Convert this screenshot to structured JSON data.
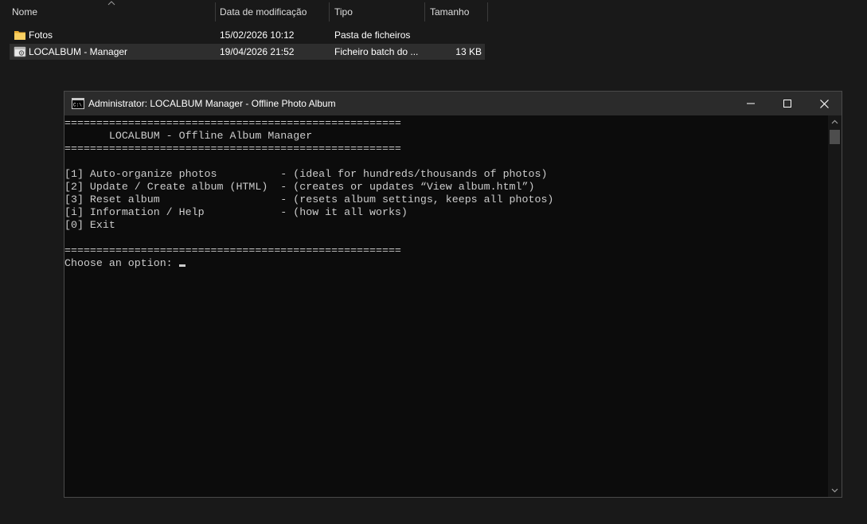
{
  "explorer": {
    "columns": {
      "name": "Nome",
      "modified": "Data de modificação",
      "type": "Tipo",
      "size": "Tamanho"
    },
    "rows": [
      {
        "name": "Fotos",
        "modified": "15/02/2026 10:12",
        "type": "Pasta de ficheiros",
        "size": "",
        "icon": "folder-icon"
      },
      {
        "name": "LOCALBUM - Manager",
        "modified": "19/04/2026 21:52",
        "type": "Ficheiro batch do ...",
        "size": "13 KB",
        "icon": "batch-file-icon"
      }
    ]
  },
  "console": {
    "title": "Administrator:  LOCALBUM Manager - Offline Photo Album",
    "lines": [
      "=====================================================",
      "       LOCALBUM - Offline Album Manager",
      "=====================================================",
      "",
      "[1] Auto-organize photos          - (ideal for hundreds/thousands of photos)",
      "[2] Update / Create album (HTML)  - (creates or updates “View album.html”)",
      "[3] Reset album                   - (resets album settings, keeps all photos)",
      "[i] Information / Help            - (how it all works)",
      "[0] Exit",
      "",
      "=====================================================",
      "Choose an option: "
    ]
  },
  "colors": {
    "desktop_bg": "#191919",
    "console_bg": "#0c0c0c",
    "console_text": "#cccccc",
    "titlebar_bg": "#2b2b2b",
    "folder_yellow": "#f5c04a"
  }
}
